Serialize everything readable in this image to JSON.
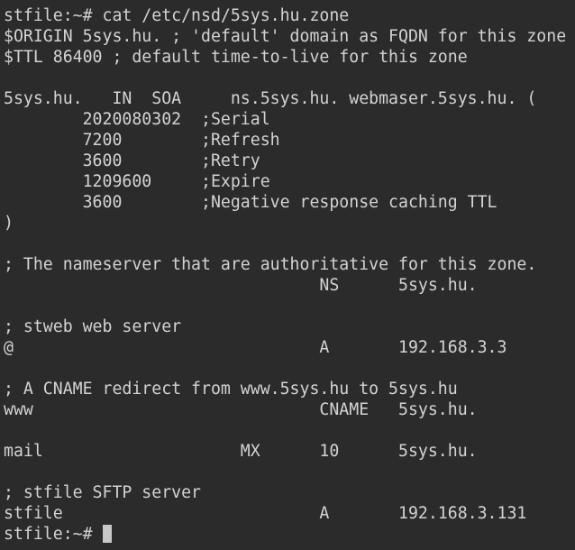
{
  "terminal": {
    "background": "#2b2b2b",
    "foreground": "#d3d3d3",
    "lines": [
      "stfile:~# cat /etc/nsd/5sys.hu.zone",
      "$ORIGIN 5sys.hu. ; 'default' domain as FQDN for this zone",
      "$TTL 86400 ; default time-to-live for this zone",
      "",
      "5sys.hu.   IN  SOA     ns.5sys.hu. webmaser.5sys.hu. (",
      "        2020080302  ;Serial",
      "        7200        ;Refresh",
      "        3600        ;Retry",
      "        1209600     ;Expire",
      "        3600        ;Negative response caching TTL",
      ")",
      "",
      "; The nameserver that are authoritative for this zone.",
      "                                NS      5sys.hu.",
      "",
      "; stweb web server",
      "@                               A       192.168.3.3",
      "",
      "; A CNAME redirect from www.5sys.hu to 5sys.hu",
      "www                             CNAME   5sys.hu.",
      "",
      "mail                    MX      10      5sys.hu.",
      "",
      "; stfile SFTP server",
      "stfile                          A       192.168.3.131"
    ],
    "prompt": "stfile:~# "
  }
}
